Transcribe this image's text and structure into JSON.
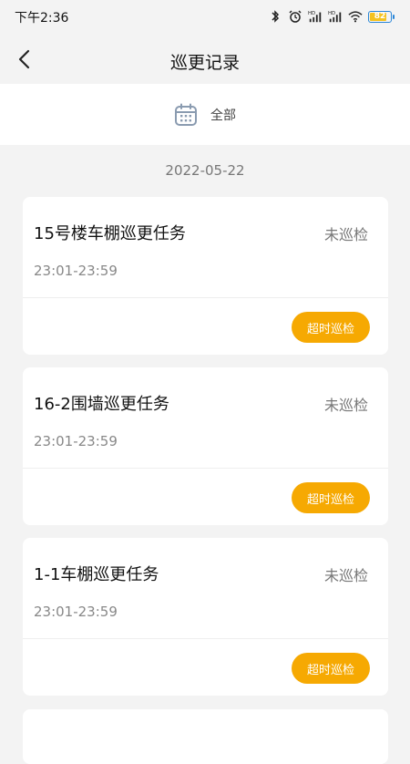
{
  "status_bar": {
    "time": "下午2:36",
    "battery": "82",
    "icons": [
      "bluetooth-icon",
      "alarm-icon",
      "signal-hd-icon",
      "signal-hd-icon",
      "wifi-icon",
      "battery-icon"
    ]
  },
  "header": {
    "title": "巡更记录",
    "back_icon": "chevron-left-icon"
  },
  "filter": {
    "label": "全部",
    "icon": "calendar-icon"
  },
  "date": "2022-05-22",
  "tasks": [
    {
      "title": "15号楼车棚巡更任务",
      "status": "未巡检",
      "time": "23:01-23:59",
      "action": "超时巡检"
    },
    {
      "title": "16-2围墙巡更任务",
      "status": "未巡检",
      "time": "23:01-23:59",
      "action": "超时巡检"
    },
    {
      "title": "1-1车棚巡更任务",
      "status": "未巡检",
      "time": "23:01-23:59",
      "action": "超时巡检"
    }
  ],
  "colors": {
    "accent": "#f6a902",
    "background": "#f3f3f3",
    "card": "#ffffff"
  }
}
